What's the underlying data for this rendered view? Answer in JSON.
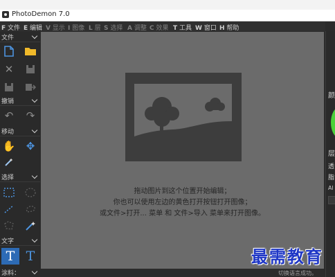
{
  "window": {
    "title": "PhotoDemon 7.0"
  },
  "menu": [
    {
      "key": "F",
      "label": "文件"
    },
    {
      "key": "E",
      "label": "编辑"
    },
    {
      "key": "V",
      "label": "显示"
    },
    {
      "key": "I",
      "label": "图像"
    },
    {
      "key": "L",
      "label": "层"
    },
    {
      "key": "S",
      "label": "选择"
    },
    {
      "key": "A",
      "label": "调整"
    },
    {
      "key": "C",
      "label": "效果"
    },
    {
      "key": "T",
      "label": "工具"
    },
    {
      "key": "W",
      "label": "窗口"
    },
    {
      "key": "H",
      "label": "帮助"
    }
  ],
  "toolbox": {
    "file": "文件",
    "undo": "撤销",
    "move": "移动",
    "select": "选择",
    "text": "文字",
    "paint": "涂料："
  },
  "canvas": {
    "hint_line1": "拖动图片到这个位置开始编辑；",
    "hint_line2": "你也可以使用左边的黄色打开按钮打开图像；",
    "hint_line3": "或文件>打开... 菜单 和 文件>导入 菜单来打开图像。"
  },
  "status": {
    "message": "切换语言成功。"
  },
  "right_panel": {
    "label1": "颜",
    "label2": "层",
    "label3": "透",
    "label4": "脂",
    "label5": "Al"
  },
  "watermark": "最需教育",
  "colors": {
    "canvas_bg": "#6b6b6b",
    "panel_bg": "#2a2a2a",
    "accent_blue": "#2d6bb5",
    "open_folder": "#f0b92a",
    "status_green": "#4bd13a",
    "watermark_blue": "#1f37c6"
  },
  "icons": {
    "new": "new-document-icon",
    "open": "open-folder-icon",
    "close": "close-image-icon",
    "save": "save-icon",
    "save_as": "save-as-icon",
    "export": "export-icon",
    "undo": "undo-icon",
    "redo": "redo-icon",
    "hand": "hand-pan-icon",
    "move": "move-arrows-icon",
    "picker": "color-picker-icon",
    "rect_select": "rect-select-icon",
    "ellipse_select": "ellipse-select-icon",
    "line_select": "line-select-icon",
    "lasso_select": "lasso-select-icon",
    "polygon_select": "polygon-select-icon",
    "wand": "magic-wand-icon",
    "text_basic": "text-tool-icon",
    "text_advanced": "typography-tool-icon"
  }
}
